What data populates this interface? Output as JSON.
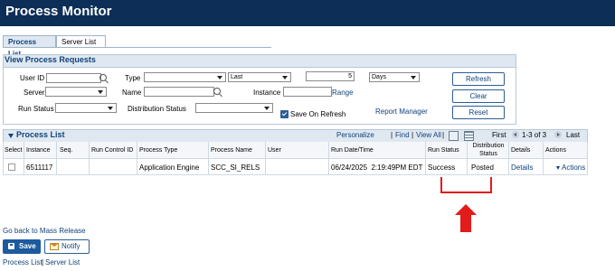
{
  "page": {
    "title": "Process Monitor"
  },
  "tabs": [
    {
      "label": "Process List",
      "active": true
    },
    {
      "label": "Server List",
      "active": false
    }
  ],
  "view_requests": {
    "title": "View Process Requests",
    "labels": {
      "user_id": "User ID",
      "type": "Type",
      "server": "Server",
      "name": "Name",
      "instance": "Instance",
      "range": "Range",
      "run_status": "Run Status",
      "distribution_status": "Distribution Status",
      "save_on_refresh": "Save On Refresh",
      "report_manager": "Report Manager"
    },
    "values": {
      "user_id": "",
      "type": "",
      "last": "Last",
      "count": "5",
      "days": "Days",
      "server": "",
      "name": "",
      "instance": "",
      "run_status": "",
      "distribution_status": ""
    },
    "save_on_refresh_checked": true,
    "buttons": {
      "refresh": "Refresh",
      "clear": "Clear",
      "reset": "Reset"
    }
  },
  "process_list": {
    "title": "Process List",
    "controls": {
      "personalize": "Personalize",
      "sep1": "|",
      "find": "Find",
      "sep2": "|",
      "view_all": "View All",
      "sep3": "|",
      "first": "First",
      "range": "1-3 of 3",
      "last": "Last"
    },
    "columns": {
      "select": "Select",
      "instance": "Instance",
      "seq": "Seq.",
      "run_control_id": "Run Control ID",
      "process_type": "Process Type",
      "process_name": "Process Name",
      "user": "User",
      "run_datetime": "Run Date/Time",
      "run_status": "Run Status",
      "dist_status_line1": "Distribution",
      "dist_status_line2": "Status",
      "details": "Details",
      "actions": "Actions"
    },
    "rows": [
      {
        "instance": "6511117",
        "seq": "",
        "run_control_id": "",
        "process_type": "Application Engine",
        "process_name": "SCC_SI_RELS",
        "user": "",
        "run_datetime": "06/24/2025  2:19:49PM EDT",
        "run_status": "Success",
        "dist_status": "Posted",
        "details": "Details",
        "actions": "Actions"
      }
    ]
  },
  "footer": {
    "mass_release_link": "Go back to Mass Release",
    "save_button": "Save",
    "notify_button": "Notify",
    "bottom_link_1": "Process List",
    "bottom_sep": "|",
    "bottom_link_2": "Server List"
  },
  "colors": {
    "header_bg": "#0d2e57",
    "link": "#10427a",
    "highlight": "#e21b1b",
    "group_bg": "#dfe8f1"
  },
  "annotations": {
    "highlight_box": "red-outline",
    "pointer": "red-up-arrow"
  }
}
